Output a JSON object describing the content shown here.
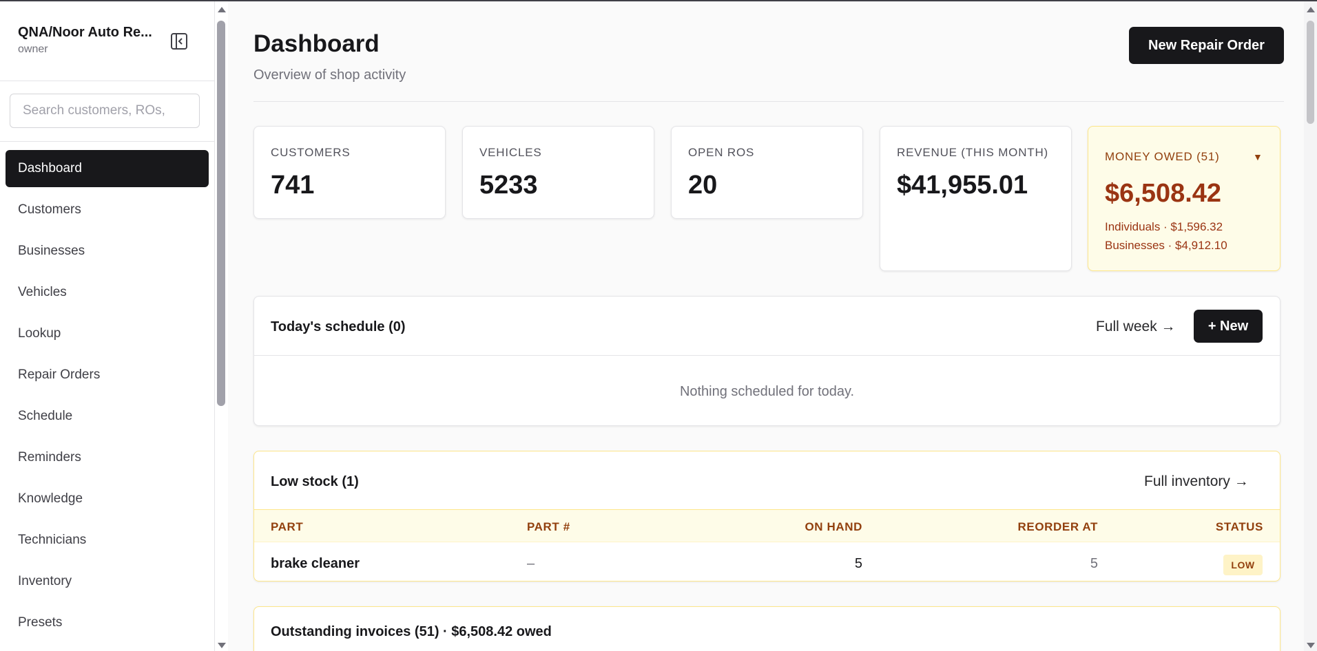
{
  "sidebar": {
    "shop_name": "QNA/Noor Auto Re...",
    "role": "owner",
    "search_placeholder": "Search customers, ROs,",
    "items": [
      {
        "label": "Dashboard"
      },
      {
        "label": "Customers"
      },
      {
        "label": "Businesses"
      },
      {
        "label": "Vehicles"
      },
      {
        "label": "Lookup"
      },
      {
        "label": "Repair Orders"
      },
      {
        "label": "Schedule"
      },
      {
        "label": "Reminders"
      },
      {
        "label": "Knowledge"
      },
      {
        "label": "Technicians"
      },
      {
        "label": "Inventory"
      },
      {
        "label": "Presets"
      }
    ]
  },
  "header": {
    "title": "Dashboard",
    "subtitle": "Overview of shop activity",
    "new_ro_label": "New Repair Order"
  },
  "stats": {
    "customers": {
      "label": "CUSTOMERS",
      "value": "741"
    },
    "vehicles": {
      "label": "VEHICLES",
      "value": "5233"
    },
    "open_ros": {
      "label": "OPEN ROS",
      "value": "20"
    },
    "revenue": {
      "label": "REVENUE (THIS MONTH)",
      "value": "$41,955.01"
    },
    "owed": {
      "label": "MONEY OWED (51)",
      "caret": "▼",
      "value": "$6,508.42",
      "individuals": "Individuals · $1,596.32",
      "businesses": "Businesses · $4,912.10"
    }
  },
  "schedule": {
    "title": "Today's schedule (0)",
    "full_week": "Full week →",
    "new_label": "+ New",
    "empty": "Nothing scheduled for today."
  },
  "low_stock": {
    "title": "Low stock (1)",
    "full_inventory": "Full inventory →",
    "columns": {
      "part": "PART",
      "part_no": "PART #",
      "on_hand": "ON HAND",
      "reorder_at": "REORDER AT",
      "status": "STATUS"
    },
    "rows": [
      {
        "part": "brake cleaner",
        "part_no": "–",
        "on_hand": "5",
        "reorder_at": "5",
        "status": "LOW"
      }
    ]
  },
  "outstanding": {
    "title": "Outstanding invoices (51) · $6,508.42 owed"
  },
  "colors": {
    "primary": "#18181b",
    "owed_bg": "#fefce8",
    "owed_text": "#9a3412"
  }
}
